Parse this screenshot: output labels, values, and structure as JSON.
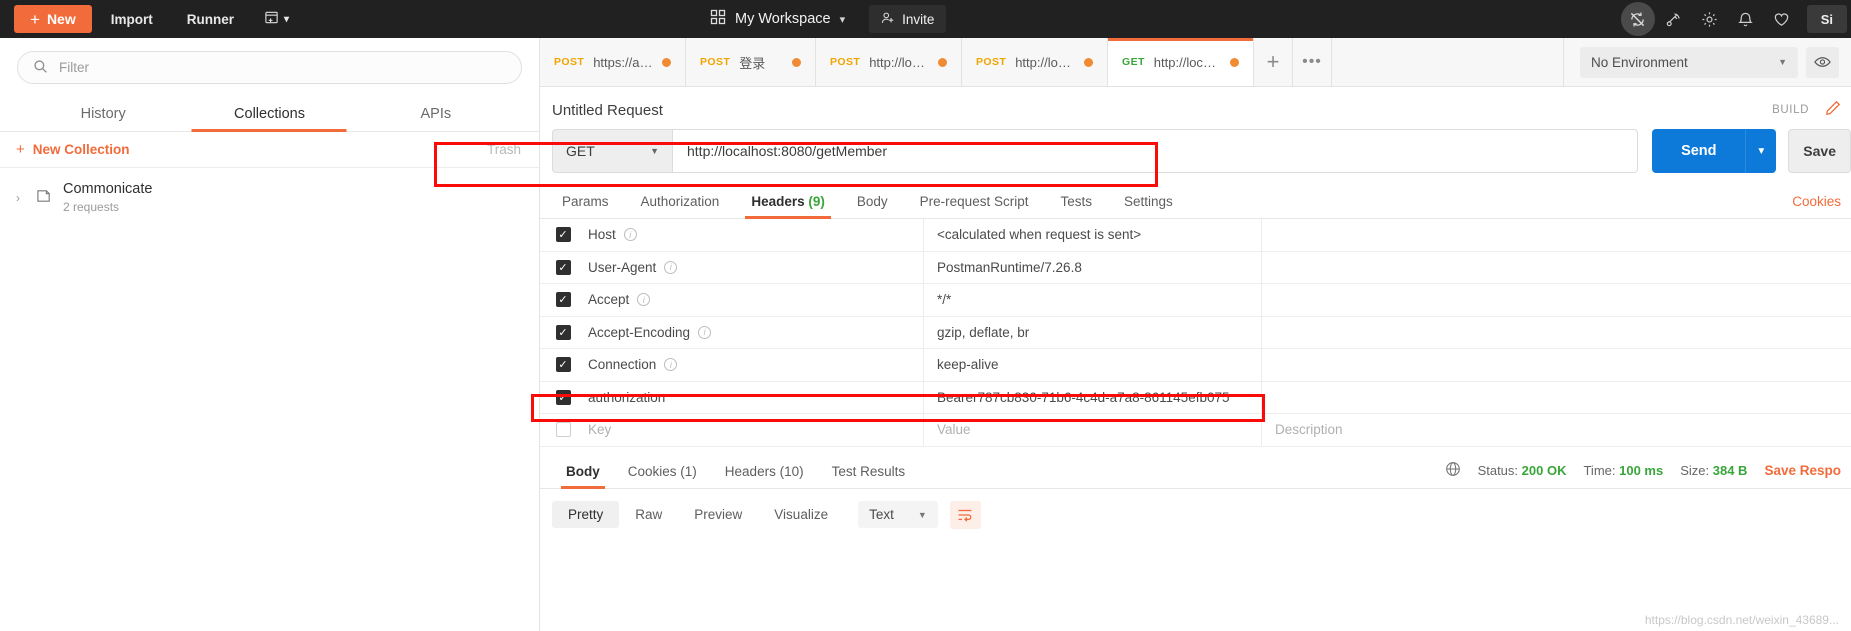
{
  "topbar": {
    "new_button": "New",
    "import_button": "Import",
    "runner_button": "Runner",
    "new_window_icon": "new-window-icon",
    "workspace_icon": "grid-icon",
    "workspace_label": "My Workspace",
    "workspace_caret": "⌄",
    "invite_label": "Invite",
    "invite_icon": "person-add-icon",
    "icons": [
      "sync-off-icon",
      "satellite-icon",
      "gear-icon",
      "bell-icon",
      "heart-icon"
    ],
    "signin_label": "Si"
  },
  "sidebar": {
    "search_icon": "search-icon",
    "filter_placeholder": "Filter",
    "tabs": [
      {
        "label": "History",
        "active": false
      },
      {
        "label": "Collections",
        "active": true
      },
      {
        "label": "APIs",
        "active": false
      }
    ],
    "new_collection_label": "New Collection",
    "new_collection_plus": "+",
    "trash_label": "Trash",
    "collection": {
      "chevron": "›",
      "folder_icon": "folder-icon",
      "name": "Commonicate",
      "subtitle": "2 requests"
    }
  },
  "tabs_bar": {
    "tabs": [
      {
        "method": "POST",
        "url": "https://api....",
        "unsaved": true,
        "active": false
      },
      {
        "method": "POST",
        "url": "登录",
        "unsaved": true,
        "active": false
      },
      {
        "method": "POST",
        "url": "http://local...",
        "unsaved": true,
        "active": false
      },
      {
        "method": "POST",
        "url": "http://local...",
        "unsaved": true,
        "active": false
      },
      {
        "method": "GET",
        "url": "http://localh...",
        "unsaved": true,
        "active": true
      }
    ],
    "add_tab": "+",
    "more_tabs": "•••",
    "environment": "No Environment",
    "environment_caret": "▼",
    "eye_icon": "eye-icon"
  },
  "request": {
    "title": "Untitled Request",
    "build_label": "BUILD",
    "edit_icon": "pencil-icon",
    "method": "GET",
    "method_caret": "▼",
    "url": "http://localhost:8080/getMember",
    "send_label": "Send",
    "send_caret": "▼",
    "save_label": "Save",
    "subtabs": [
      {
        "label": "Params",
        "count": "",
        "active": false
      },
      {
        "label": "Authorization",
        "count": "",
        "active": false
      },
      {
        "label": "Headers",
        "count": "(9)",
        "active": true
      },
      {
        "label": "Body",
        "count": "",
        "active": false
      },
      {
        "label": "Pre-request Script",
        "count": "",
        "active": false
      },
      {
        "label": "Tests",
        "count": "",
        "active": false
      },
      {
        "label": "Settings",
        "count": "",
        "active": false
      }
    ],
    "cookies_link": "Cookies",
    "headers_table": {
      "columns": {
        "key": "Key",
        "value": "Value",
        "description": "Description"
      },
      "rows": [
        {
          "checked": true,
          "key": "Host",
          "info": true,
          "value": "<calculated when request is sent>",
          "description": ""
        },
        {
          "checked": true,
          "key": "User-Agent",
          "info": true,
          "value": "PostmanRuntime/7.26.8",
          "description": ""
        },
        {
          "checked": true,
          "key": "Accept",
          "info": true,
          "value": "*/*",
          "description": ""
        },
        {
          "checked": true,
          "key": "Accept-Encoding",
          "info": true,
          "value": "gzip, deflate, br",
          "description": ""
        },
        {
          "checked": true,
          "key": "Connection",
          "info": true,
          "value": "keep-alive",
          "description": ""
        },
        {
          "checked": true,
          "key": "authorization",
          "info": false,
          "value": "Bearer787cb830-71b6-4c4d-a7a8-861145efb075",
          "description": ""
        }
      ]
    }
  },
  "response": {
    "tabs": [
      {
        "label": "Body",
        "count": "",
        "active": true
      },
      {
        "label": "Cookies",
        "count": "(1)",
        "active": false
      },
      {
        "label": "Headers",
        "count": "(10)",
        "active": false
      },
      {
        "label": "Test Results",
        "count": "",
        "active": false
      }
    ],
    "globe_icon": "globe-icon",
    "status_label": "Status:",
    "status_value": "200 OK",
    "time_label": "Time:",
    "time_value": "100 ms",
    "size_label": "Size:",
    "size_value": "384 B",
    "save_response": "Save Respo",
    "format_tabs": [
      {
        "label": "Pretty",
        "active": true
      },
      {
        "label": "Raw",
        "active": false
      },
      {
        "label": "Preview",
        "active": false
      },
      {
        "label": "Visualize",
        "active": false
      }
    ],
    "format_select": "Text",
    "format_caret": "▼",
    "wrap_icon": "wrap-lines-icon",
    "watermark": "https://blog.csdn.net/weixin_43689..."
  },
  "annotations": [
    {
      "name": "url-bar-highlight"
    },
    {
      "name": "authorization-header-highlight"
    }
  ],
  "colors": {
    "accent": "#f26b3a",
    "send_blue": "#0d7ad9",
    "get_green": "#3aa53a",
    "post_orange": "#f0a400",
    "annotation_red": "#fb0b07"
  }
}
